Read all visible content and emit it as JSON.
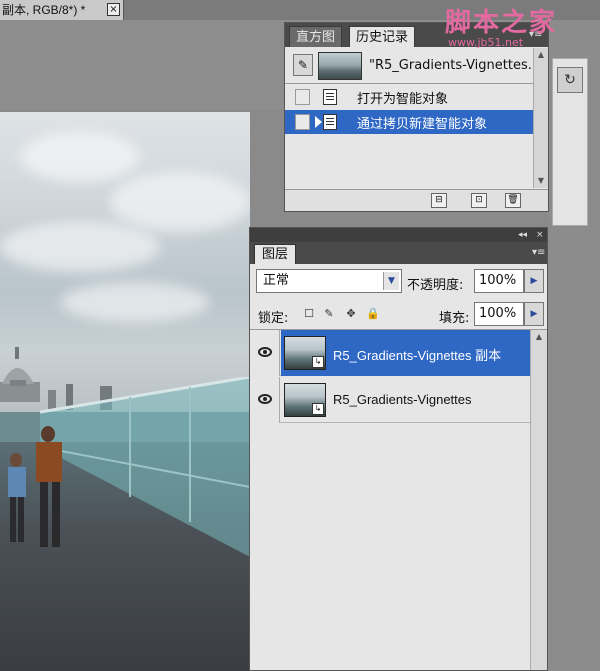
{
  "document": {
    "tab_title": "副本, RGB/8*) *",
    "close_glyph": "×"
  },
  "history": {
    "tabs": [
      {
        "label": "直方图",
        "active": false
      },
      {
        "label": "历史记录",
        "active": true
      }
    ],
    "menu_glyph": "▾≡",
    "snapshot_label": "\"R5_Gradients-Vignettes...",
    "steps": [
      {
        "label": "打开为智能对象",
        "selected": false
      },
      {
        "label": "通过拷贝新建智能对象",
        "selected": true
      }
    ],
    "scroll_up": "▲",
    "scroll_down": "▼",
    "buttons": [
      "⊟",
      "⊡",
      "🗑"
    ]
  },
  "layers": {
    "topbar_collapse": "◂◂",
    "topbar_close": "×",
    "tab_label": "图层",
    "menu_glyph": "▾≡",
    "blend_mode": "正常",
    "blend_dropdown_glyph": "▼",
    "opacity_label": "不透明度:",
    "opacity_value": "100%",
    "lock_label": "锁定:",
    "lock_icons": [
      "☐",
      "✎",
      "✥",
      "🔒"
    ],
    "fill_label": "填充:",
    "fill_value": "100%",
    "stepper_glyph": "▶",
    "rows": [
      {
        "name": "R5_Gradients-Vignettes 副本",
        "selected": true,
        "visible": true
      },
      {
        "name": "R5_Gradients-Vignettes",
        "selected": false,
        "visible": true
      }
    ],
    "smart_object_glyph": "↳"
  },
  "dock": {
    "history_icon_glyph": "↻"
  },
  "watermark": {
    "title": "脚本之家",
    "url": "www.jb51.net"
  },
  "colors": {
    "selection": "#2f68c4",
    "panel_bg": "#e6e6e6",
    "panel_dark": "#4a4a4a",
    "watermark": "#e36aa0"
  }
}
